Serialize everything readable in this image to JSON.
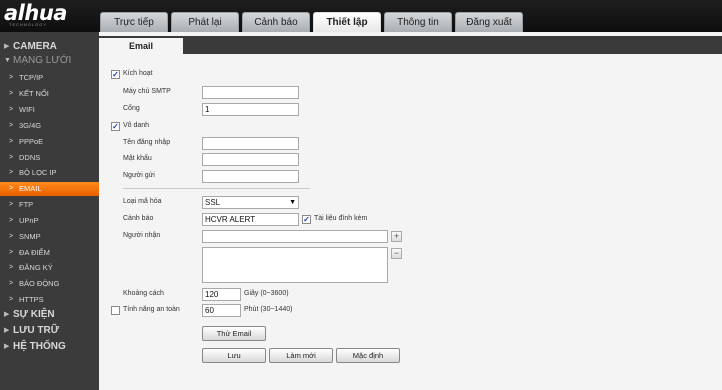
{
  "logo": {
    "text": "alhua",
    "sub": "TECHNOLOGY"
  },
  "top_tabs": [
    "Trực tiếp",
    "Phát lại",
    "Cảnh báo",
    "Thiết lập",
    "Thông tin",
    "Đăng xuất"
  ],
  "sidebar": {
    "camera": "CAMERA",
    "network": "MẠNG LƯỚI",
    "network_items": [
      "TCP/IP",
      "KẾT NỐI",
      "WIFI",
      "3G/4G",
      "PPPoE",
      "DDNS",
      "BỘ LỌC IP",
      "EMAIL",
      "FTP",
      "UPnP",
      "SNMP",
      "ĐA ĐIỂM",
      "ĐĂNG KÝ",
      "BÁO ĐỘNG",
      "HTTPS"
    ],
    "event": "SỰ KIỆN",
    "storage": "LƯU TRỮ",
    "system": "HỆ THỐNG"
  },
  "content": {
    "tab": "Email",
    "enable_label": "Kích hoạt",
    "smtp_label": "Máy chủ SMTP",
    "smtp_value": "",
    "port_label": "Cổng",
    "port_value": "1",
    "anonymous_label": "Vô danh",
    "username_label": "Tên đăng nhập",
    "password_label": "Mật khẩu",
    "sender_label": "Người gửi",
    "encryption_label": "Loại mã hóa",
    "encryption_value": "SSL",
    "subject_label": "Cảnh báo",
    "subject_value": "HCVR ALERT",
    "attachment_label": "Tài liệu đính kèm",
    "receiver_label": "Người nhận",
    "plus": "+",
    "minus": "−",
    "interval_label": "Khoảng cách",
    "interval_value": "120",
    "interval_unit": "Giây (0~3600)",
    "health_label": "Tính năng an toàn",
    "health_value": "60",
    "health_unit": "Phút (30~1440)",
    "test_button": "Thử Email",
    "save_button": "Lưu",
    "refresh_button": "Làm mới",
    "default_button": "Mặc định",
    "checked_mark": "✓",
    "caret": "▼"
  }
}
